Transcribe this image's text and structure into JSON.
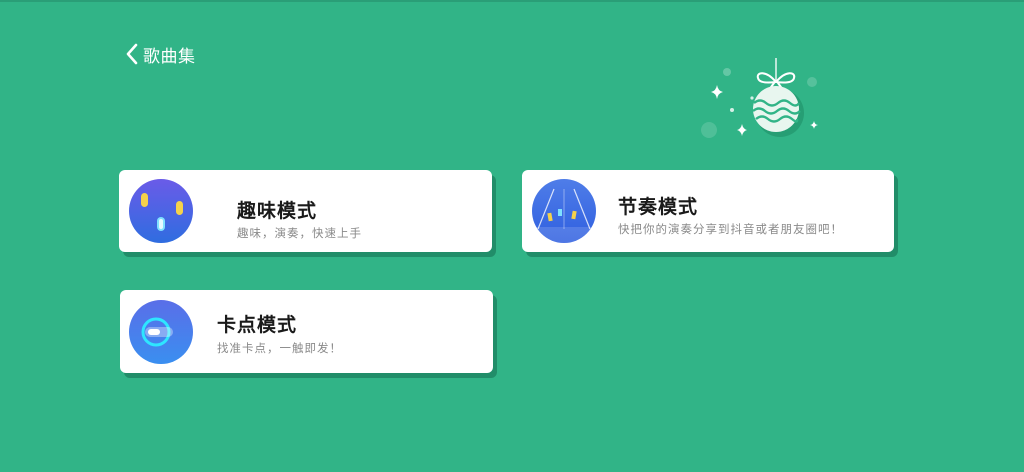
{
  "header": {
    "back_label": "歌曲集"
  },
  "modes": [
    {
      "title": "趣味模式",
      "subtitle": "趣味，演奏，快速上手",
      "icon": "fun-mode-icon"
    },
    {
      "title": "节奏模式",
      "subtitle": "快把你的演奏分享到抖音或者朋友圈吧！",
      "icon": "rhythm-mode-icon"
    },
    {
      "title": "卡点模式",
      "subtitle": "找准卡点，一触即发！",
      "icon": "beat-mode-icon"
    }
  ],
  "colors": {
    "background": "#31b487",
    "card": "#ffffff",
    "title": "#1a1a1a",
    "subtitle": "#8a8a8a",
    "icon_gradient_top": "#5a8cf0",
    "icon_gradient_bottom": "#3a52d8"
  }
}
